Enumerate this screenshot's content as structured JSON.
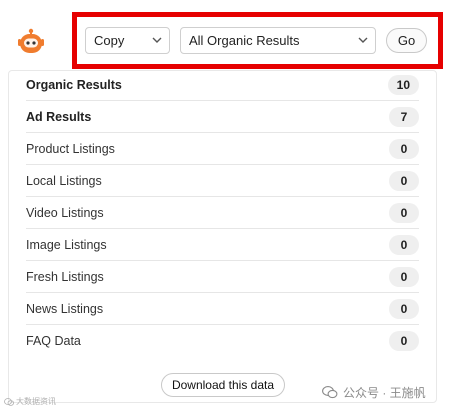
{
  "toolbar": {
    "copy_select": "Copy",
    "results_select": "All Organic Results",
    "go_label": "Go"
  },
  "results": [
    {
      "label": "Organic Results",
      "count": "10",
      "emphasis": true
    },
    {
      "label": "Ad Results",
      "count": "7",
      "emphasis": true
    },
    {
      "label": "Product Listings",
      "count": "0",
      "emphasis": false
    },
    {
      "label": "Local Listings",
      "count": "0",
      "emphasis": false
    },
    {
      "label": "Video Listings",
      "count": "0",
      "emphasis": false
    },
    {
      "label": "Image Listings",
      "count": "0",
      "emphasis": false
    },
    {
      "label": "Fresh Listings",
      "count": "0",
      "emphasis": false
    },
    {
      "label": "News Listings",
      "count": "0",
      "emphasis": false
    },
    {
      "label": "FAQ Data",
      "count": "0",
      "emphasis": false
    }
  ],
  "download_label": "Download this data",
  "watermark": {
    "left": "大数据资讯",
    "right": "公众号 · 王施帆"
  },
  "colors": {
    "highlight_frame": "#e60000",
    "avatar": "#f07c2e"
  },
  "icons": {
    "avatar": "robot-avatar-icon",
    "select_chevron": "chevron-down-icon",
    "wechat": "wechat-icon"
  }
}
